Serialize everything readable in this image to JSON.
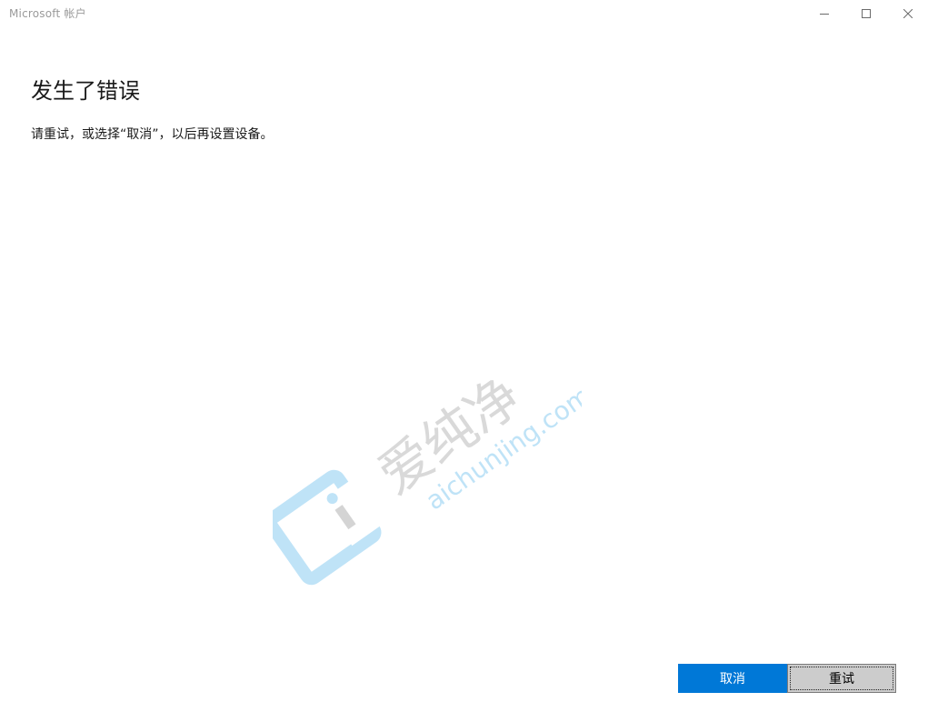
{
  "window": {
    "title": "Microsoft 帐户",
    "controls": {
      "minimize": "minimize-icon",
      "maximize": "maximize-icon",
      "close": "close-icon"
    }
  },
  "content": {
    "heading": "发生了错误",
    "message": "请重试，或选择“取消”，以后再设置设备。"
  },
  "actions": {
    "cancel_label": "取消",
    "retry_label": "重试"
  },
  "watermark": {
    "text_cn": "爱纯净",
    "text_url": "aichunjing.com"
  },
  "colors": {
    "accent": "#0078d7",
    "secondary_button": "#cccccc",
    "title_text": "#9a9a9a"
  }
}
